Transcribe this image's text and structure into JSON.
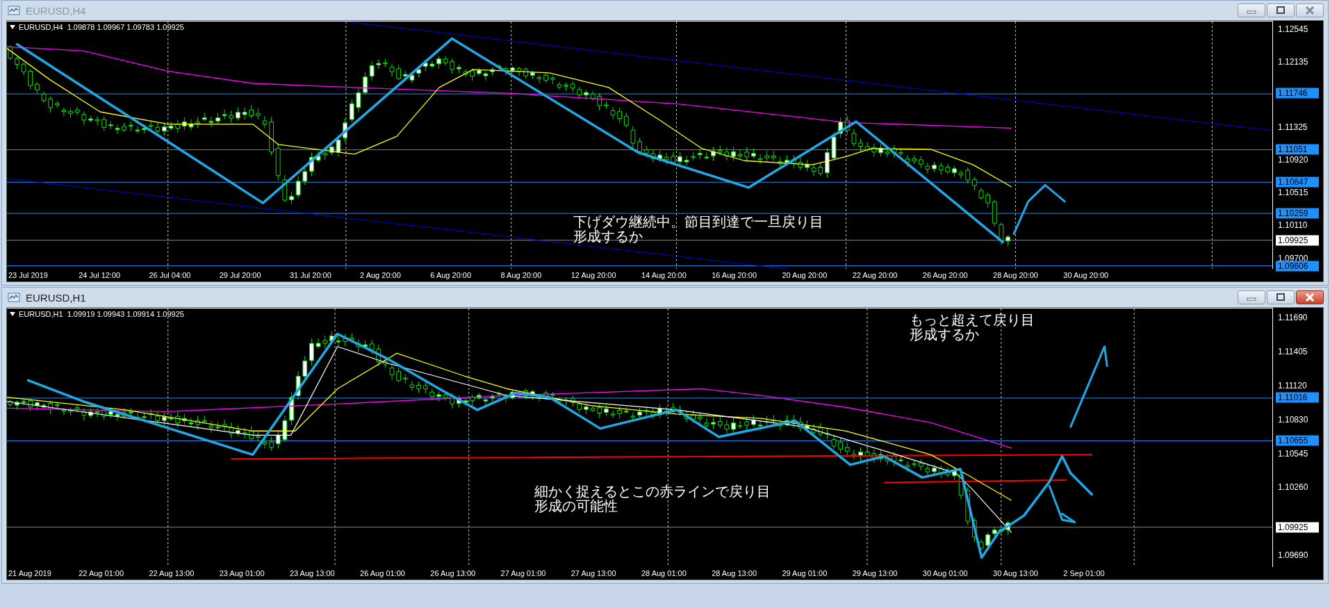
{
  "windows": [
    {
      "title": "EURUSD,H4",
      "active": false,
      "info": "EURUSD,H4  1.09878 1.09967 1.09783 1.09925",
      "price_axis": [
        {
          "text": "1.12545",
          "kind": "tick"
        },
        {
          "text": "1.12135",
          "kind": "tick"
        },
        {
          "text": "1.11746",
          "kind": "level"
        },
        {
          "text": "1.11325",
          "kind": "tick"
        },
        {
          "text": "1.11051",
          "kind": "level"
        },
        {
          "text": "1.10920",
          "kind": "tick"
        },
        {
          "text": "1.10647",
          "kind": "level"
        },
        {
          "text": "1.10515",
          "kind": "tick"
        },
        {
          "text": "1.10259",
          "kind": "level"
        },
        {
          "text": "1.10110",
          "kind": "tick"
        },
        {
          "text": "1.09925",
          "kind": "current"
        },
        {
          "text": "1.09700",
          "kind": "tick"
        },
        {
          "text": "1.09606",
          "kind": "level"
        }
      ],
      "time_labels": [
        "23 Jul 2019",
        "24 Jul 12:00",
        "26 Jul 04:00",
        "29 Jul 20:00",
        "31 Jul 20:00",
        "2 Aug 20:00",
        "6 Aug 20:00",
        "8 Aug 20:00",
        "12 Aug 20:00",
        "14 Aug 20:00",
        "16 Aug 20:00",
        "20 Aug 20:00",
        "22 Aug 20:00",
        "26 Aug 20:00",
        "28 Aug 20:00",
        "30 Aug 20:00"
      ],
      "annotations": [
        "下げダウ継続中。節目到達で一旦戻り目形成するか"
      ]
    },
    {
      "title": "EURUSD,H1",
      "active": true,
      "info": "EURUSD,H1  1.09919 1.09943 1.09914 1.09925",
      "price_axis": [
        {
          "text": "1.11690",
          "kind": "tick"
        },
        {
          "text": "1.11405",
          "kind": "tick"
        },
        {
          "text": "1.11120",
          "kind": "tick"
        },
        {
          "text": "1.11016",
          "kind": "level"
        },
        {
          "text": "1.10830",
          "kind": "tick"
        },
        {
          "text": "1.10655",
          "kind": "level"
        },
        {
          "text": "1.10545",
          "kind": "tick"
        },
        {
          "text": "1.10260",
          "kind": "tick"
        },
        {
          "text": "1.09925",
          "kind": "current"
        },
        {
          "text": "1.09690",
          "kind": "tick"
        }
      ],
      "time_labels": [
        "21 Aug 2019",
        "22 Aug 01:00",
        "22 Aug 13:00",
        "23 Aug 01:00",
        "23 Aug 13:00",
        "26 Aug 01:00",
        "26 Aug 13:00",
        "27 Aug 01:00",
        "27 Aug 13:00",
        "28 Aug 01:00",
        "28 Aug 13:00",
        "29 Aug 01:00",
        "29 Aug 13:00",
        "30 Aug 01:00",
        "30 Aug 13:00",
        "2 Sep 01:00"
      ],
      "annotations": [
        "もっと超えて戻り目形成するか",
        "細かく捉えるとこの赤ラインで戻り目形成の可能性"
      ]
    }
  ]
}
